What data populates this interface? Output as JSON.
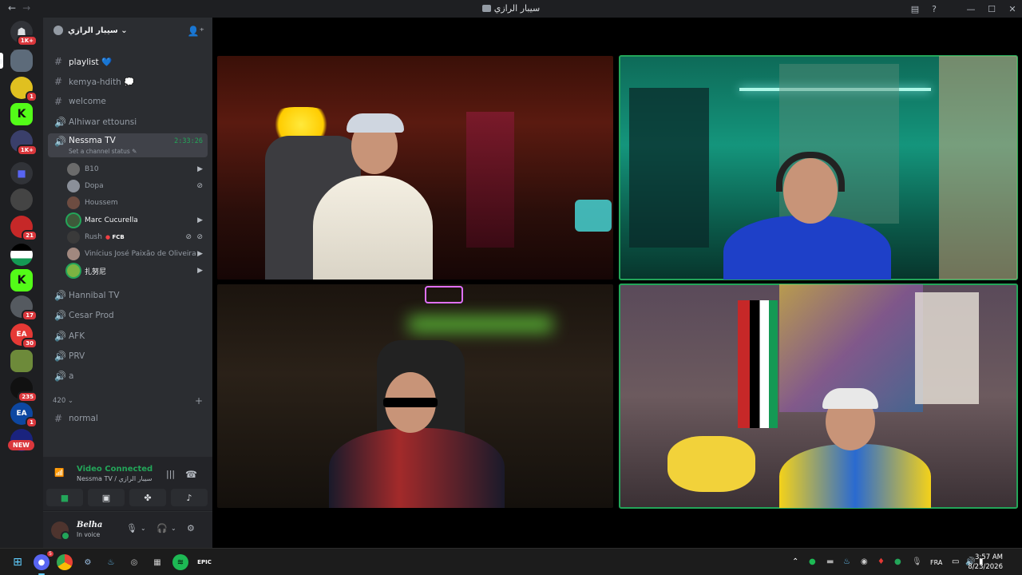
{
  "titlebar": {
    "back": "←",
    "forward": "→",
    "title": "سيبار الرازي",
    "inbox_icon": "inbox-icon",
    "help": "?",
    "minimize": "—",
    "maximize": "☐",
    "close": "✕"
  },
  "rail": {
    "badges": [
      "1K+",
      "1",
      "1K+",
      "21",
      "17",
      "30",
      "235",
      "1"
    ],
    "new_label": "NEW"
  },
  "server": {
    "name": "سيبار الرازي ⌄"
  },
  "channels": [
    {
      "name": "playlist 💙",
      "icon": "#"
    },
    {
      "name": "kemya-hdith 💭",
      "icon": "#"
    },
    {
      "name": "welcome",
      "icon": "#"
    },
    {
      "name": "Alhiwar ettounsi",
      "icon": "🔊"
    },
    {
      "name": "Nessma TV",
      "icon": "🔊",
      "timer": "2:33:26",
      "status": "Set a channel status ✎"
    }
  ],
  "voice_users": [
    {
      "name": "B10",
      "color": "#6b6b6b"
    },
    {
      "name": "Dopa",
      "color": "#8a8f99"
    },
    {
      "name": "Houssem",
      "color": "#6d4c41"
    },
    {
      "name": "Marc Cucurella",
      "color": "#3e5a3a"
    },
    {
      "name": "Rush",
      "color": "#3a3a3a",
      "tag": "FCB"
    },
    {
      "name": "Vinícius José Paixão de Oliveira",
      "color": "#a1887f"
    },
    {
      "name": "扎努尼",
      "color": "#7cb342"
    }
  ],
  "channels_after": [
    {
      "name": "Hannibal TV",
      "icon": "🔊"
    },
    {
      "name": "Cesar Prod",
      "icon": "🔊"
    },
    {
      "name": "AFK",
      "icon": "🔊"
    },
    {
      "name": "PRV",
      "icon": "🔊"
    },
    {
      "name": "a",
      "icon": "🔊"
    }
  ],
  "category": {
    "name": "420 ⌄",
    "add": "+"
  },
  "channels_cat": [
    {
      "name": "normal",
      "icon": "#"
    }
  ],
  "voice_panel": {
    "title": "Video Connected",
    "subtitle": "Nessma TV / سيبار الرازي",
    "signal_icon": "signal-icon"
  },
  "user": {
    "name": "Belha",
    "status": "In voice"
  },
  "taskbar": {
    "lang": "FRA",
    "time": "3:57 AM",
    "date": "8/23/2026",
    "discord_badge": "5"
  },
  "colors": {
    "accent_green": "#23a559",
    "sidebar_bg": "#2b2d31",
    "rail_bg": "#1e1f22",
    "danger": "#da373c"
  }
}
